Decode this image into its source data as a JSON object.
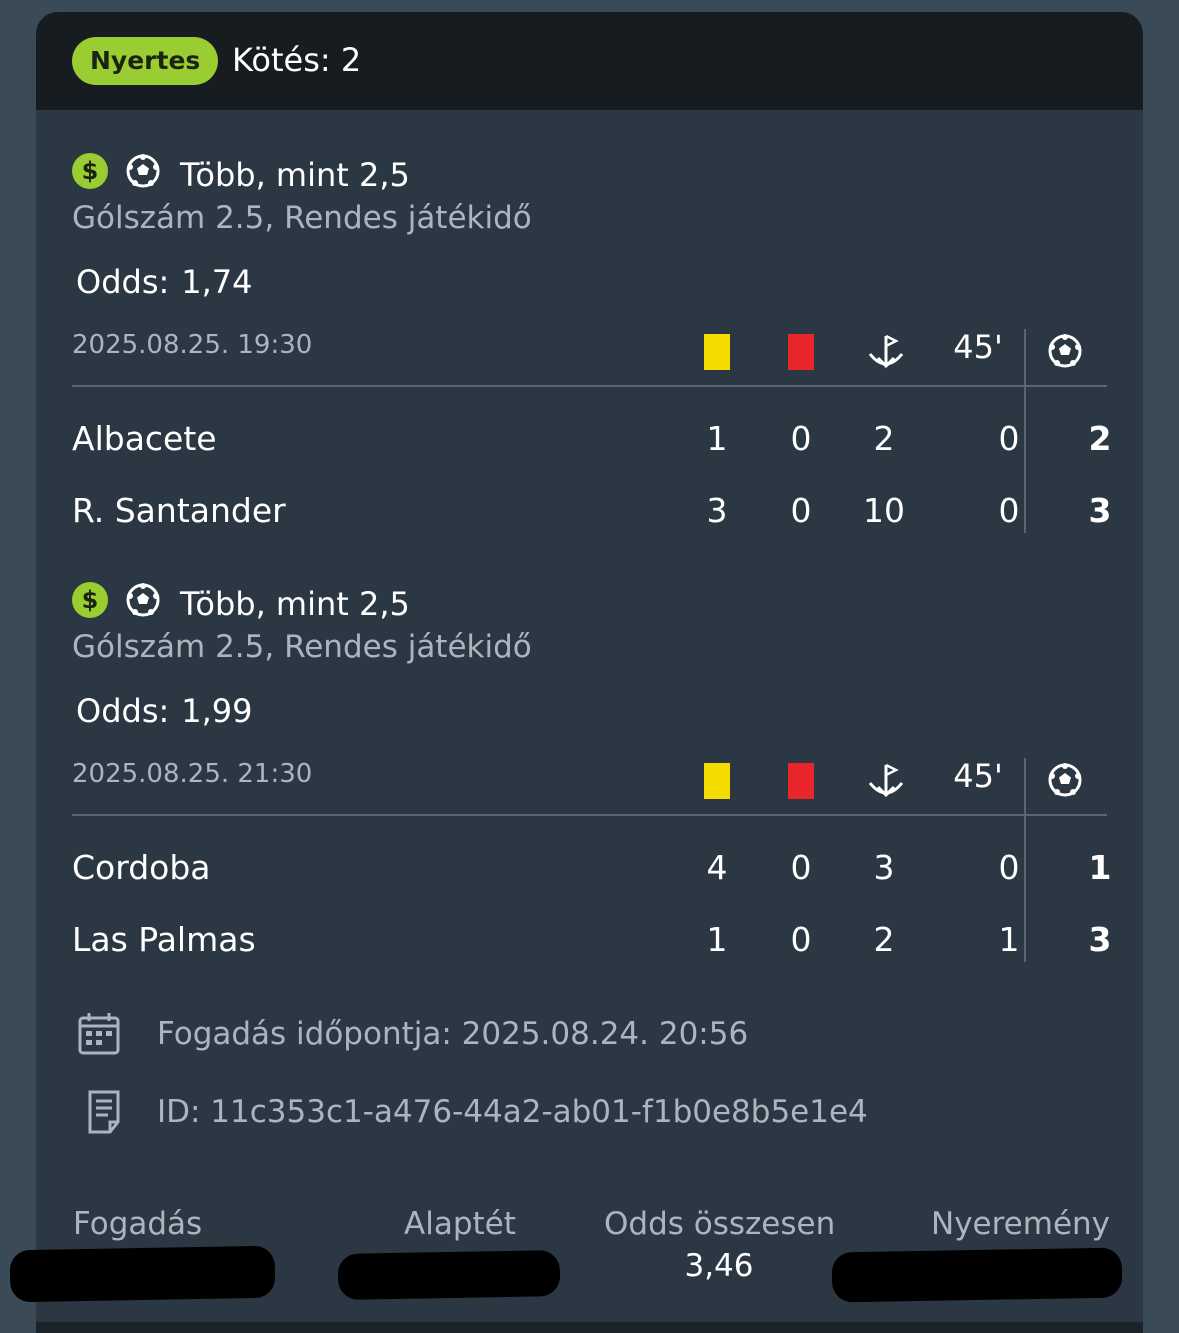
{
  "header": {
    "status_badge": "Nyertes",
    "bet_type": "Kötés: 2"
  },
  "bets": [
    {
      "market": "Több, mint 2,5",
      "submarket": "Gólszám 2.5, Rendes játékidő",
      "odds_label": "Odds:",
      "odds_value": "1,74",
      "datetime": "2025.08.25.  19:30",
      "half_label": "45'",
      "teams": [
        {
          "name": "Albacete",
          "yellow": "1",
          "red": "0",
          "corners": "2",
          "half": "0",
          "goals": "2"
        },
        {
          "name": "R. Santander",
          "yellow": "3",
          "red": "0",
          "corners": "10",
          "half": "0",
          "goals": "3"
        }
      ]
    },
    {
      "market": "Több, mint 2,5",
      "submarket": "Gólszám 2.5, Rendes játékidő",
      "odds_label": "Odds:",
      "odds_value": "1,99",
      "datetime": "2025.08.25.  21:30",
      "half_label": "45'",
      "teams": [
        {
          "name": "Cordoba",
          "yellow": "4",
          "red": "0",
          "corners": "3",
          "half": "0",
          "goals": "1"
        },
        {
          "name": "Las Palmas",
          "yellow": "1",
          "red": "0",
          "corners": "2",
          "half": "1",
          "goals": "3"
        }
      ]
    }
  ],
  "meta": {
    "placed_at": "Fogadás időpontja:  2025.08.24.  20:56",
    "bet_id": "ID: 11c353c1-a476-44a2-ab01-f1b0e8b5e1e4"
  },
  "footer": {
    "fogadas_label": "Fogadás",
    "alaptet_label": "Alaptét",
    "odds_total_label": "Odds összesen",
    "odds_total_value": "3,46",
    "nyeremeny_label": "Nyeremény"
  },
  "colors": {
    "accent_green": "#9acd32",
    "yellow_card": "#f5dc00",
    "red_card": "#e8262b",
    "card_bg": "#2b3843",
    "header_bg": "#171c21"
  },
  "icons": [
    "dollar-icon",
    "football-icon",
    "yellow-card-icon",
    "red-card-icon",
    "corner-flag-icon",
    "calendar-icon",
    "receipt-icon"
  ]
}
